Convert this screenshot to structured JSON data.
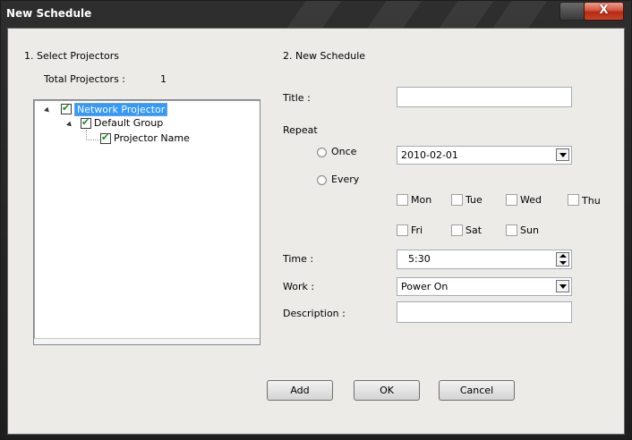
{
  "window": {
    "title": "New Schedule",
    "close_glyph": "X"
  },
  "left": {
    "section_title": "1. Select Projectors",
    "total_label": "Total Projectors :",
    "total_value": "1",
    "tree": {
      "root": "Network Projector",
      "group": "Default Group",
      "leaf": "Projector Name"
    }
  },
  "right": {
    "section_title": "2. New Schedule",
    "title_label": "Title :",
    "title_value": "",
    "repeat_label": "Repeat",
    "once_label": "Once",
    "every_label": "Every",
    "date_value": "2010-02-01",
    "days": [
      "Mon",
      "Tue",
      "Wed",
      "Thu",
      "Fri",
      "Sat",
      "Sun"
    ],
    "time_label": "Time :",
    "time_value": "5:30",
    "work_label": "Work :",
    "work_value": "Power On",
    "description_label": "Description :",
    "description_value": ""
  },
  "buttons": {
    "add": "Add",
    "ok": "OK",
    "cancel": "Cancel"
  }
}
